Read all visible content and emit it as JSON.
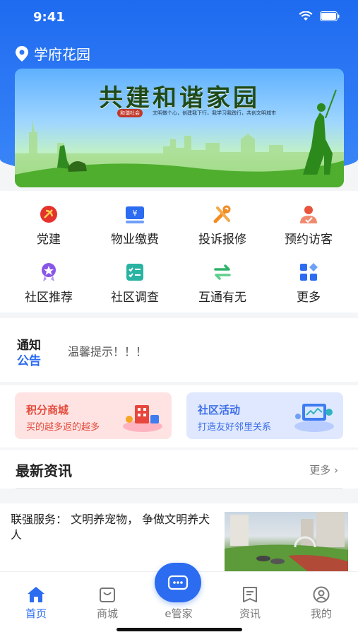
{
  "status": {
    "time": "9:41"
  },
  "location": {
    "name": "学府花园"
  },
  "banner": {
    "title": "共建和谐家园",
    "tag": "和谐社会",
    "subtitle": "文明做个心，创建我下行，我学习我践行，共创文明城市"
  },
  "services": [
    {
      "label": "党建",
      "icon": "party-icon"
    },
    {
      "label": "物业缴费",
      "icon": "payment-icon"
    },
    {
      "label": "投诉报修",
      "icon": "repair-icon"
    },
    {
      "label": "预约访客",
      "icon": "visitor-icon"
    },
    {
      "label": "社区推荐",
      "icon": "recommend-icon"
    },
    {
      "label": "社区调查",
      "icon": "survey-icon"
    },
    {
      "label": "互通有无",
      "icon": "exchange-icon"
    },
    {
      "label": "更多",
      "icon": "more-icon"
    }
  ],
  "notice": {
    "label_line1": "通知",
    "label_line2": "公告",
    "text": "温馨提示！！！"
  },
  "promos": [
    {
      "title": "积分商城",
      "subtitle": "买的越多返的越多"
    },
    {
      "title": "社区活动",
      "subtitle": "打造友好邻里关系"
    }
  ],
  "news": {
    "title": "最新资讯",
    "more": "更多",
    "items": [
      {
        "text": "联强服务： 文明养宠物， 争做文明养犬人"
      }
    ]
  },
  "tabbar": {
    "items": [
      {
        "label": "首页",
        "active": true
      },
      {
        "label": "商城",
        "active": false
      },
      {
        "label": "e管家",
        "active": false
      },
      {
        "label": "资讯",
        "active": false
      },
      {
        "label": "我的",
        "active": false
      }
    ]
  },
  "colors": {
    "primary": "#2b6cf0",
    "header_blue": "#2f7bf5",
    "promo_red": "#e34c3c",
    "promo_blue": "#3d6ee8"
  }
}
